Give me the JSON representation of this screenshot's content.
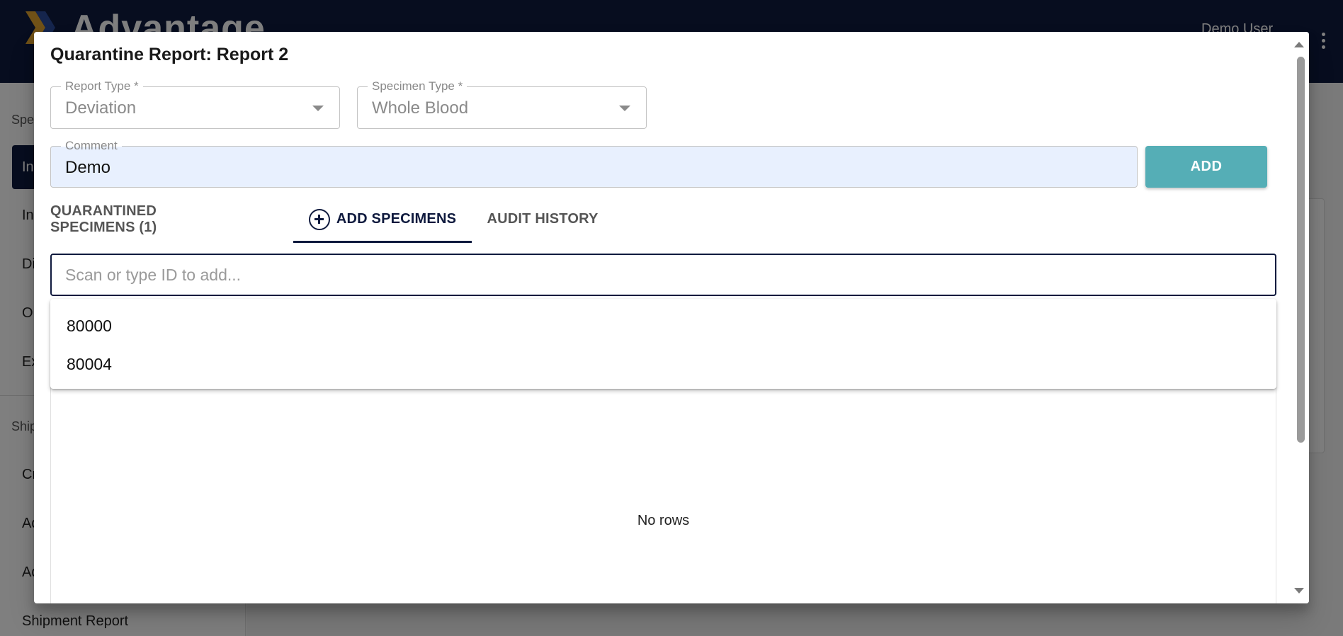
{
  "app": {
    "brand": "Advantage",
    "user_name": "Demo User",
    "sidebar": {
      "section_specimens": "Spec",
      "items": [
        "In",
        "In",
        "Di",
        "O",
        "Ex"
      ],
      "section_shipments": "Ship",
      "ship_items": [
        "Cr",
        "Ad",
        "Ad",
        "Shipment Report"
      ]
    }
  },
  "dialog": {
    "title": "Quarantine Report: Report 2",
    "report_type": {
      "label": "Report Type *",
      "value": "Deviation"
    },
    "specimen_type": {
      "label": "Specimen Type *",
      "value": "Whole Blood"
    },
    "comment": {
      "label": "Comment",
      "value": "Demo"
    },
    "add_button": "ADD",
    "tabs": [
      {
        "label": "QUARANTINED SPECIMENS (1)",
        "icon": ""
      },
      {
        "label": "ADD SPECIMENS",
        "icon": "plus-circle-icon"
      },
      {
        "label": "AUDIT HISTORY",
        "icon": ""
      }
    ],
    "active_tab": 1,
    "scan": {
      "placeholder": "Scan or type ID to add...",
      "value": ""
    },
    "suggestions": [
      "80000",
      "80004"
    ],
    "grid": {
      "empty_text": "No rows"
    }
  },
  "colors": {
    "header": "#0f1a3e",
    "accent": "#55aeb6",
    "autofill": "#e8f0fe"
  }
}
